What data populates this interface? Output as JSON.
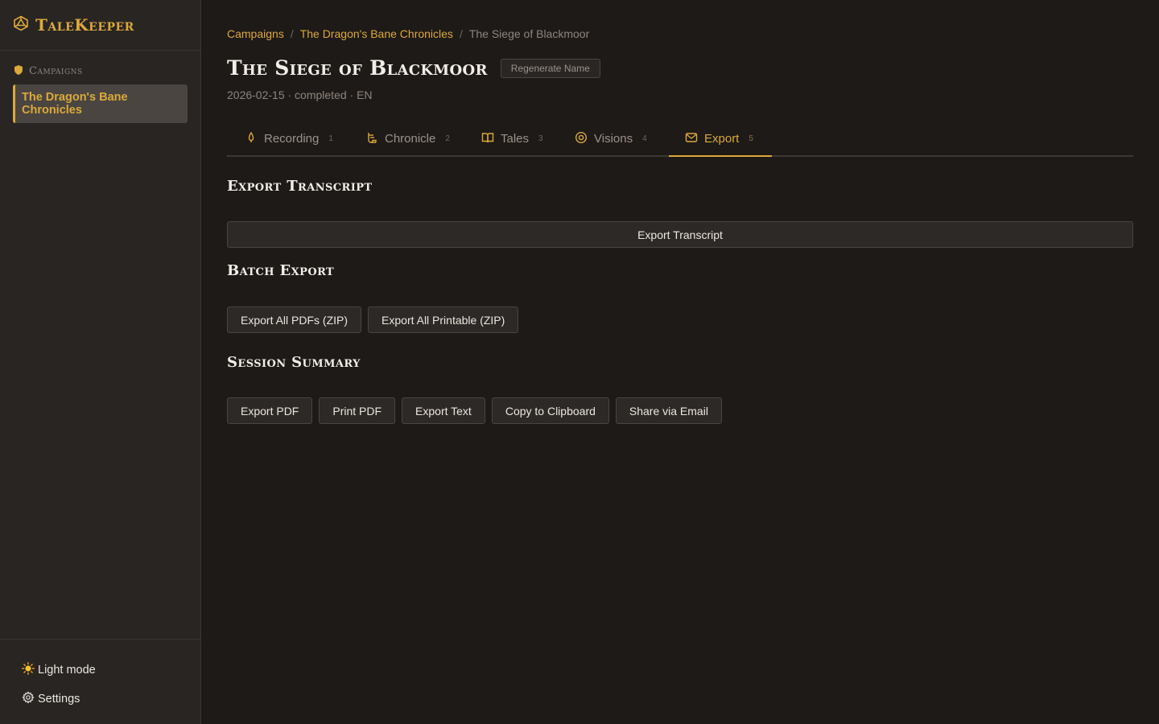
{
  "app": {
    "name": "TaleKeeper",
    "accent": "#dca93a"
  },
  "sidebar": {
    "heading": "Campaigns",
    "items": [
      {
        "label": "The Dragon's Bane Chronicles",
        "active": true
      }
    ],
    "bottom": {
      "light_mode_label": "Light mode",
      "settings_label": "Settings"
    }
  },
  "breadcrumb": {
    "items": [
      "Campaigns",
      "The Dragon's Bane Chronicles"
    ],
    "current": "The Siege of Blackmoor",
    "separator": "/"
  },
  "session": {
    "title": "The Siege of Blackmoor",
    "regenerate_label": "Regenerate Name",
    "meta": "2026-02-15 · completed · EN"
  },
  "tabs": [
    {
      "label": "Recording",
      "count": "1",
      "icon": "microphone-icon"
    },
    {
      "label": "Chronicle",
      "count": "2",
      "icon": "scroll-icon"
    },
    {
      "label": "Tales",
      "count": "3",
      "icon": "book-icon"
    },
    {
      "label": "Visions",
      "count": "4",
      "icon": "eye-target-icon"
    },
    {
      "label": "Export",
      "count": "5",
      "icon": "envelope-icon",
      "active": true
    }
  ],
  "export_transcript": {
    "title": "Export Transcript",
    "button": "Export Transcript"
  },
  "batch_export": {
    "title": "Batch Export",
    "buttons": [
      "Export All PDFs (ZIP)",
      "Export All Printable (ZIP)"
    ]
  },
  "session_summary": {
    "title": "Session Summary",
    "buttons": [
      "Export PDF",
      "Print PDF",
      "Export Text",
      "Copy to Clipboard",
      "Share via Email"
    ]
  }
}
